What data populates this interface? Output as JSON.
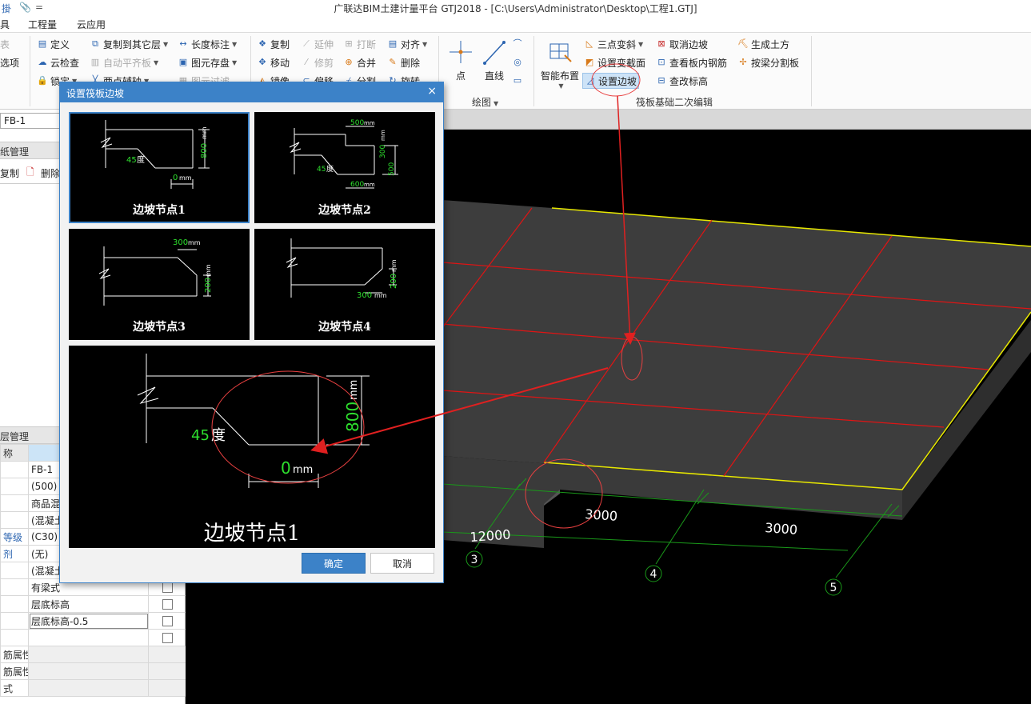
{
  "titlebar": {
    "title": "广联达BIM土建计量平台 GTJ2018 - [C:\\Users\\Administrator\\Desktop\\工程1.GTJ]",
    "qa1": "掛",
    "qa2": "📎",
    "qa3": "="
  },
  "menu": {
    "items": [
      "具",
      "工程量",
      "云应用"
    ]
  },
  "ribbon": {
    "edge": {
      "biao": "表",
      "xuanxiang": "选项"
    },
    "col1": {
      "define": "定义",
      "cloud_check": "云检查",
      "lock": "锁定"
    },
    "col2": {
      "copy_to_floor": "复制到其它层",
      "auto_flat": "自动平齐板",
      "two_point_axis": "两点辅轴"
    },
    "col3": {
      "length_mark": "长度标注",
      "elem_store": "图元存盘",
      "elem_filter": "图元过滤"
    },
    "col4": {
      "copy": "复制",
      "move": "移动",
      "mirror": "镜像"
    },
    "col5": {
      "extend": "延伸",
      "trim": "修剪",
      "offset": "偏移"
    },
    "col6": {
      "break": "打断",
      "merge": "合并",
      "split": "分割"
    },
    "col7": {
      "align": "对齐",
      "delete": "删除",
      "rotate": "旋转"
    },
    "draw": {
      "point": "点",
      "line": "直线",
      "group": "绘图"
    },
    "smart": {
      "label": "智能布置"
    },
    "raft": {
      "three_point_slope": "三点变斜",
      "set_var_section": "设置变截面",
      "set_slope": "设置边坡",
      "cancel_slope": "取消边坡",
      "view_rebar": "查看板内钢筋",
      "check_elev": "查改标高",
      "gen_earth": "生成土方",
      "split_by_beam": "按梁分割板",
      "group": "筏板基础二次编辑"
    }
  },
  "left": {
    "name_field": "FB-1",
    "drawing_mgmt": "纸管理",
    "copy": "复制",
    "delete": "删除",
    "layer_mgmt": "层管理",
    "props": [
      {
        "name": "称",
        "value": "",
        "hdr": true
      },
      {
        "name": "",
        "value": "FB-1"
      },
      {
        "name": "",
        "value": "(500)"
      },
      {
        "name": "",
        "value": "商品混"
      },
      {
        "name": "",
        "value": "(混凝土"
      },
      {
        "name": "等级",
        "value": "(C30)",
        "blue": true
      },
      {
        "name": "剂",
        "value": "(无)",
        "blue": true
      },
      {
        "name": "",
        "value": "(混凝土"
      },
      {
        "name": "",
        "value": "有梁式",
        "check": true
      },
      {
        "name": "",
        "value": "层底标高",
        "check": true
      },
      {
        "name": "",
        "value": "层底标高-0.5",
        "check": true,
        "sel": true
      },
      {
        "name": "",
        "value": "",
        "check": true
      },
      {
        "name": "筋属性",
        "value": "",
        "gray": true
      },
      {
        "name": "筋属性",
        "value": "",
        "gray": true
      },
      {
        "name": "式",
        "value": "",
        "gray": true
      }
    ]
  },
  "viewport": {
    "dim_a": "3000",
    "dim_b": "3000",
    "dim_total": "12000",
    "axis_3": "3",
    "axis_4": "4",
    "axis_5": "5"
  },
  "dialog": {
    "title": "设置筏板边坡",
    "close": "×",
    "tiles": [
      {
        "caption": "边坡节点1",
        "angle": "45",
        "deg": "度",
        "height": "800",
        "width": "0",
        "unit": "mm"
      },
      {
        "caption": "边坡节点2",
        "top": "500",
        "height_a": "300",
        "angle": "45",
        "deg": "度",
        "height_b": "500",
        "bottom": "600",
        "unit": "mm"
      },
      {
        "caption": "边坡节点3",
        "top": "300",
        "height": "200",
        "unit": "mm"
      },
      {
        "caption": "边坡节点4",
        "bottom": "300",
        "height": "200",
        "unit": "mm"
      }
    ],
    "preview": {
      "caption": "边坡节点1",
      "angle": "45",
      "deg": "度",
      "height": "800",
      "width": "0",
      "unit": "mm"
    },
    "ok": "确定",
    "cancel": "取消"
  }
}
